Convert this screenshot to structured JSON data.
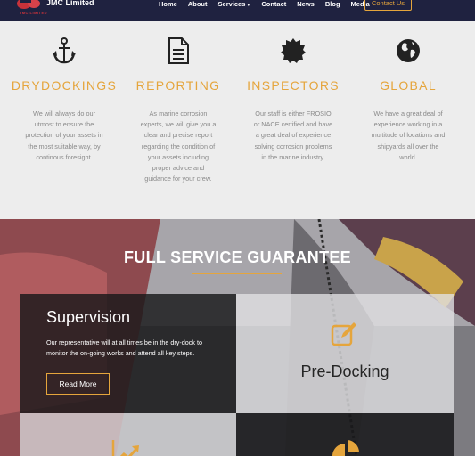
{
  "brand": {
    "name": "JMC Limited",
    "logo_text": "JMC LIMITED"
  },
  "nav": {
    "items": [
      "Home",
      "About",
      "Services",
      "Contact",
      "News",
      "Blog",
      "Media"
    ],
    "cta": "Contact Us"
  },
  "features": [
    {
      "icon": "anchor-icon",
      "title": "DRYDOCKINGS",
      "desc": "We will always do our utmost to ensure the protection of your assets in the most suitable way, by continous foresight."
    },
    {
      "icon": "document-icon",
      "title": "REPORTING",
      "desc": "As marine corrosion experts, we will give you a clear and precise report regarding the condition of your assets including proper advice and guidance for your crew."
    },
    {
      "icon": "certificate-icon",
      "title": "INSPECTORS",
      "desc": "Our staff is either FROSIO or NACE certified and have a great deal of experience solving corrosion problems in the marine industry."
    },
    {
      "icon": "globe-icon",
      "title": "GLOBAL",
      "desc": "We have a great deal of experience working in a multitude of locations and shipyards all over the world."
    }
  ],
  "hero": {
    "title": "FULL SERVICE GUARANTEE",
    "cards": [
      {
        "title": "Supervision",
        "text": "Our representative will at all times be in the dry-dock to monitor the on-going works and attend all key steps.",
        "button": "Read More"
      },
      {
        "title": "Pre-Docking",
        "icon": "edit-icon"
      },
      {
        "icon": "chart-up-icon"
      },
      {
        "icon": "pie-chart-icon"
      }
    ]
  },
  "colors": {
    "navbar": "#1f2240",
    "accent": "#e5a53c",
    "logo_red": "#c8323a",
    "text_gray": "#8a8a8a"
  }
}
